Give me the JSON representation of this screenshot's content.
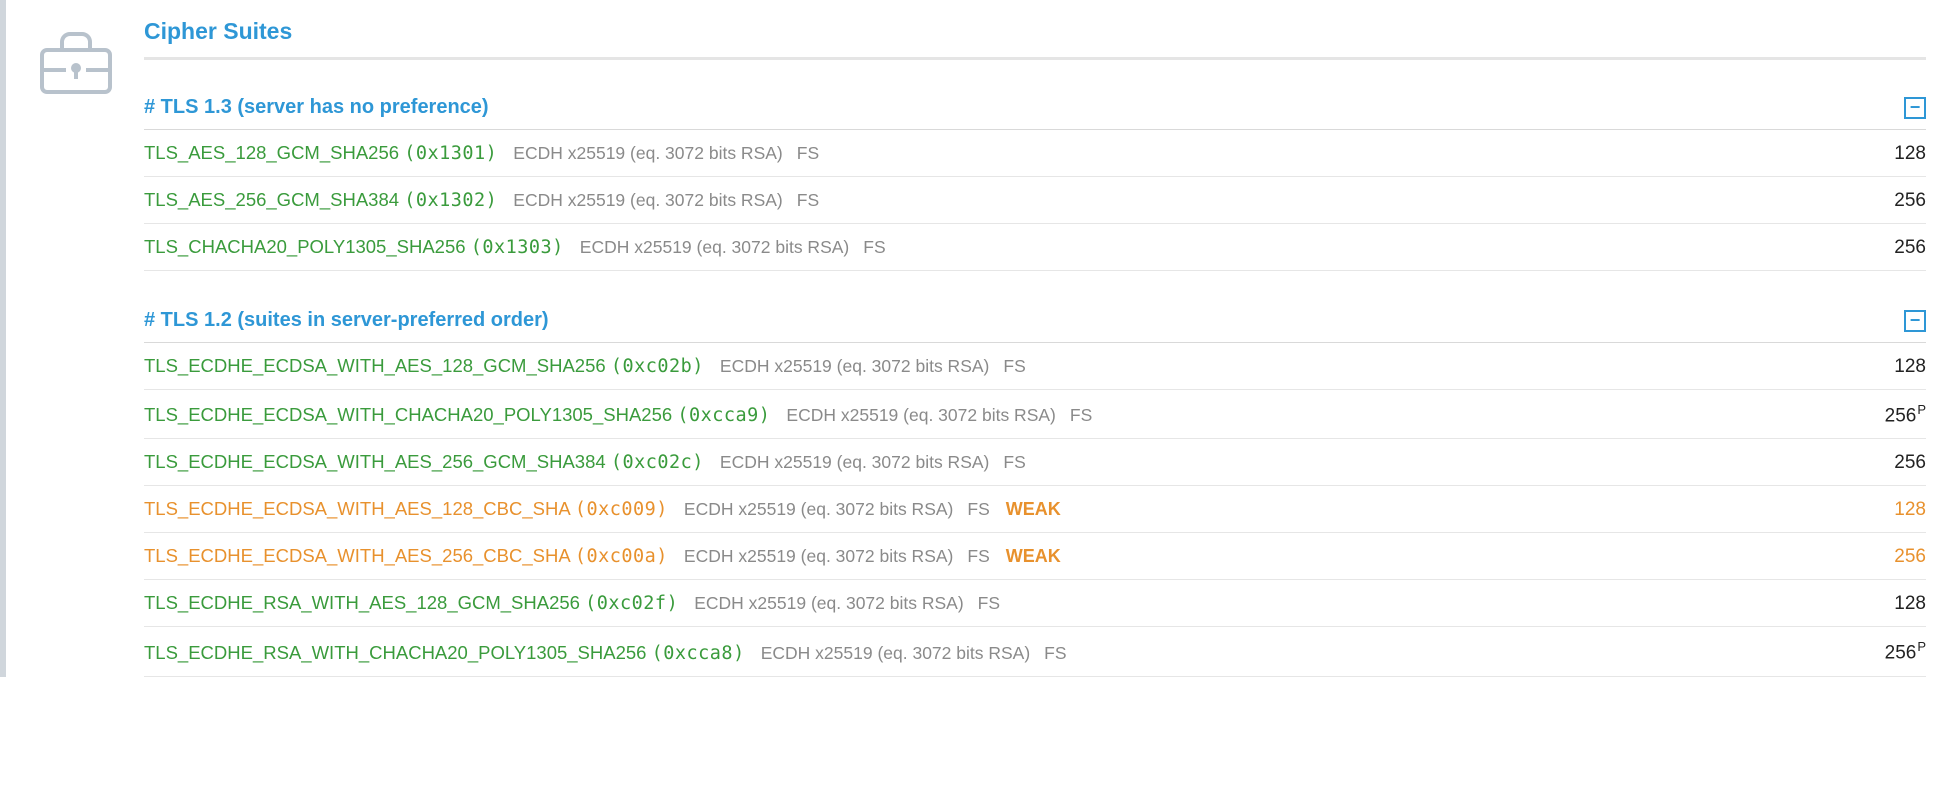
{
  "title": "Cipher Suites",
  "collapse_glyph": "−",
  "groups": [
    {
      "heading": "# TLS 1.3 (server has no preference)",
      "rows": [
        {
          "name": "TLS_AES_128_GCM_SHA256",
          "code": "(0x1301)",
          "kex": "ECDH x25519 (eq. 3072 bits RSA)",
          "fs": "FS",
          "weak": "",
          "bits": "128",
          "sup": "",
          "color": "green"
        },
        {
          "name": "TLS_AES_256_GCM_SHA384",
          "code": "(0x1302)",
          "kex": "ECDH x25519 (eq. 3072 bits RSA)",
          "fs": "FS",
          "weak": "",
          "bits": "256",
          "sup": "",
          "color": "green"
        },
        {
          "name": "TLS_CHACHA20_POLY1305_SHA256",
          "code": "(0x1303)",
          "kex": "ECDH x25519 (eq. 3072 bits RSA)",
          "fs": "FS",
          "weak": "",
          "bits": "256",
          "sup": "",
          "color": "green"
        }
      ]
    },
    {
      "heading": "# TLS 1.2 (suites in server-preferred order)",
      "rows": [
        {
          "name": "TLS_ECDHE_ECDSA_WITH_AES_128_GCM_SHA256",
          "code": "(0xc02b)",
          "kex": "ECDH x25519 (eq. 3072 bits RSA)",
          "fs": "FS",
          "weak": "",
          "bits": "128",
          "sup": "",
          "color": "green"
        },
        {
          "name": "TLS_ECDHE_ECDSA_WITH_CHACHA20_POLY1305_SHA256",
          "code": "(0xcca9)",
          "kex": "ECDH x25519 (eq. 3072 bits RSA)",
          "fs": "FS",
          "weak": "",
          "bits": "256",
          "sup": "P",
          "color": "green"
        },
        {
          "name": "TLS_ECDHE_ECDSA_WITH_AES_256_GCM_SHA384",
          "code": "(0xc02c)",
          "kex": "ECDH x25519 (eq. 3072 bits RSA)",
          "fs": "FS",
          "weak": "",
          "bits": "256",
          "sup": "",
          "color": "green"
        },
        {
          "name": "TLS_ECDHE_ECDSA_WITH_AES_128_CBC_SHA",
          "code": "(0xc009)",
          "kex": "ECDH x25519 (eq. 3072 bits RSA)",
          "fs": "FS",
          "weak": "WEAK",
          "bits": "128",
          "sup": "",
          "color": "orange"
        },
        {
          "name": "TLS_ECDHE_ECDSA_WITH_AES_256_CBC_SHA",
          "code": "(0xc00a)",
          "kex": "ECDH x25519 (eq. 3072 bits RSA)",
          "fs": "FS",
          "weak": "WEAK",
          "bits": "256",
          "sup": "",
          "color": "orange"
        },
        {
          "name": "TLS_ECDHE_RSA_WITH_AES_128_GCM_SHA256",
          "code": "(0xc02f)",
          "kex": "ECDH x25519 (eq. 3072 bits RSA)",
          "fs": "FS",
          "weak": "",
          "bits": "128",
          "sup": "",
          "color": "green"
        },
        {
          "name": "TLS_ECDHE_RSA_WITH_CHACHA20_POLY1305_SHA256",
          "code": "(0xcca8)",
          "kex": "ECDH x25519 (eq. 3072 bits RSA)",
          "fs": "FS",
          "weak": "",
          "bits": "256",
          "sup": "P",
          "color": "green"
        }
      ]
    }
  ]
}
